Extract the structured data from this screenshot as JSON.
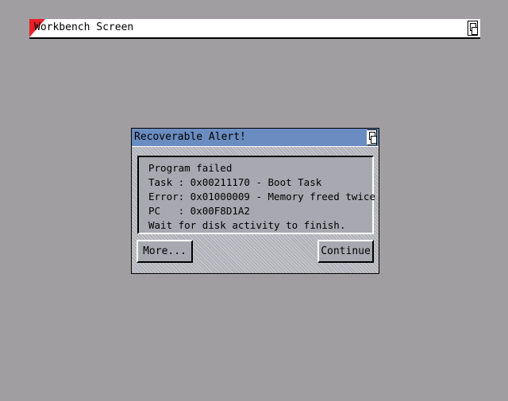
{
  "screen": {
    "title": "Workbench Screen"
  },
  "alert": {
    "title": "Recoverable Alert!",
    "message_lines": [
      "Program failed",
      "Task : 0x00211170 - Boot Task",
      "Error: 0x01000009 - Memory freed twice",
      "PC   : 0x00F8D1A2",
      "Wait for disk activity to finish."
    ],
    "buttons": {
      "more": "More...",
      "continue": "Continue"
    }
  },
  "colors": {
    "desktop": "#a09ea0",
    "screen_bar": "#ffffff",
    "screen_corner": "#e8202a",
    "alert_titlebar": "#6a8cc0",
    "alert_panel": "#a8a8b0"
  },
  "icons": {
    "screen_depth": "depth-arrange-icon",
    "window_depth": "depth-arrange-icon"
  }
}
